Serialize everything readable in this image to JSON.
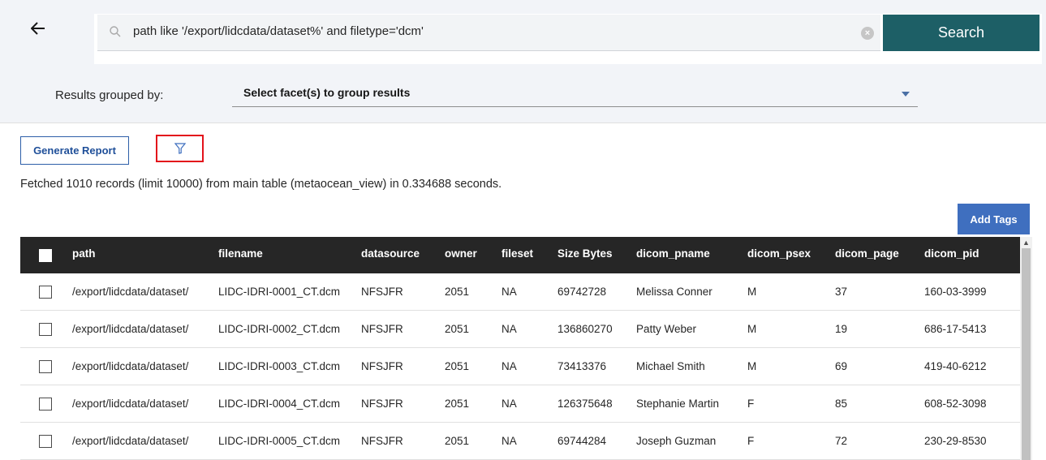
{
  "search": {
    "query": "path like '/export/lidcdata/dataset%' and filetype='dcm'",
    "button_label": "Search",
    "clear_symbol": "×"
  },
  "grouping": {
    "label": "Results grouped by:",
    "select_text": "Select facet(s) to group results"
  },
  "toolbar": {
    "generate_report_label": "Generate Report",
    "add_tags_label": "Add Tags"
  },
  "status": {
    "fetched_text": "Fetched 1010 records (limit 10000) from main table (metaocean_view) in 0.334688 seconds."
  },
  "table": {
    "columns": [
      "path",
      "filename",
      "datasource",
      "owner",
      "fileset",
      "Size Bytes",
      "dicom_pname",
      "dicom_psex",
      "dicom_page",
      "dicom_pid"
    ],
    "rows": [
      [
        "/export/lidcdata/dataset/",
        "LIDC-IDRI-0001_CT.dcm",
        "NFSJFR",
        "2051",
        "NA",
        "69742728",
        "Melissa Conner",
        "M",
        "37",
        "160-03-3999"
      ],
      [
        "/export/lidcdata/dataset/",
        "LIDC-IDRI-0002_CT.dcm",
        "NFSJFR",
        "2051",
        "NA",
        "136860270",
        "Patty Weber",
        "M",
        "19",
        "686-17-5413"
      ],
      [
        "/export/lidcdata/dataset/",
        "LIDC-IDRI-0003_CT.dcm",
        "NFSJFR",
        "2051",
        "NA",
        "73413376",
        "Michael Smith",
        "M",
        "69",
        "419-40-6212"
      ],
      [
        "/export/lidcdata/dataset/",
        "LIDC-IDRI-0004_CT.dcm",
        "NFSJFR",
        "2051",
        "NA",
        "126375648",
        "Stephanie Martin",
        "F",
        "85",
        "608-52-3098"
      ],
      [
        "/export/lidcdata/dataset/",
        "LIDC-IDRI-0005_CT.dcm",
        "NFSJFR",
        "2051",
        "NA",
        "69744284",
        "Joseph Guzman",
        "F",
        "72",
        "230-29-8530"
      ]
    ]
  },
  "icons": {
    "back": "arrow-left-icon",
    "search": "search-icon",
    "clear": "close-circle-icon",
    "caret": "caret-down-icon",
    "filter": "filter-icon"
  },
  "colors": {
    "search_button": "#1d5f66",
    "primary_blue": "#3f6fbf",
    "table_header": "#262626",
    "highlight_border": "#e3121b"
  }
}
